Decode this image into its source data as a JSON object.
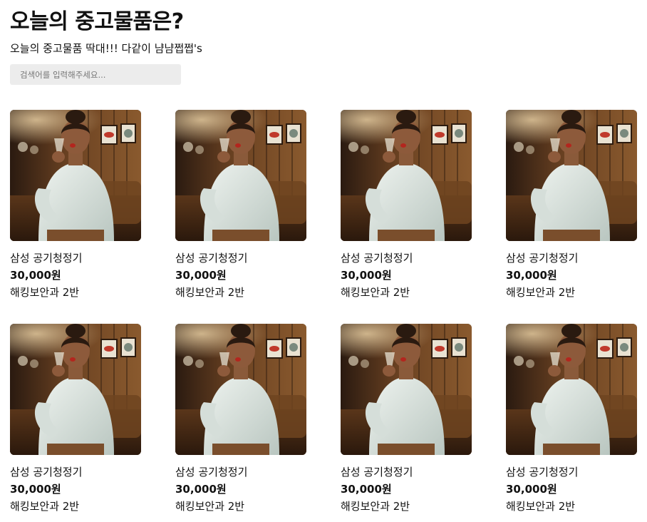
{
  "header": {
    "title": "오늘의 중고물품은?",
    "subtitle": "오늘의 중고물품 딱대!!! 다같이 냠냠쩝쩝's"
  },
  "search": {
    "placeholder": "검색어를 입력해주세요...",
    "value": ""
  },
  "products": [
    {
      "title": "삼성 공기청정기",
      "price": "30,000원",
      "seller": "해킹보안과 2반",
      "image": "product-photo"
    },
    {
      "title": "삼성 공기청정기",
      "price": "30,000원",
      "seller": "해킹보안과 2반",
      "image": "product-photo"
    },
    {
      "title": "삼성 공기청정기",
      "price": "30,000원",
      "seller": "해킹보안과 2반",
      "image": "product-photo"
    },
    {
      "title": "삼성 공기청정기",
      "price": "30,000원",
      "seller": "해킹보안과 2반",
      "image": "product-photo"
    },
    {
      "title": "삼성 공기청정기",
      "price": "30,000원",
      "seller": "해킹보안과 2반",
      "image": "product-photo"
    },
    {
      "title": "삼성 공기청정기",
      "price": "30,000원",
      "seller": "해킹보안과 2반",
      "image": "product-photo"
    },
    {
      "title": "삼성 공기청정기",
      "price": "30,000원",
      "seller": "해킹보안과 2반",
      "image": "product-photo"
    },
    {
      "title": "삼성 공기청정기",
      "price": "30,000원",
      "seller": "해킹보안과 2반",
      "image": "product-photo"
    }
  ]
}
